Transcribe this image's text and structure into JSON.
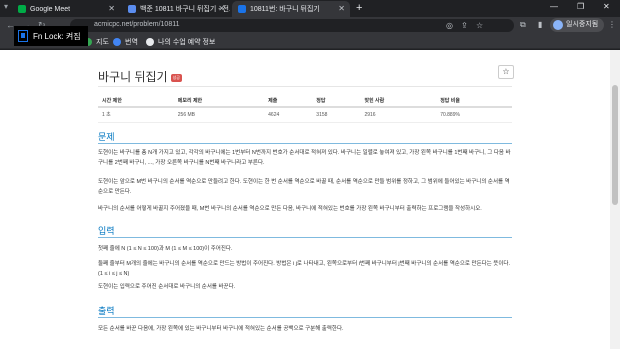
{
  "tabs": [
    {
      "label": "Google Meet",
      "active": false,
      "color": "#00ac47"
    },
    {
      "label": "백준 10811 바구니 뒤집기 - 전...",
      "active": false,
      "color": "#5b8def"
    },
    {
      "label": "10811번: 바구니 뒤집기",
      "active": true,
      "color": "#1a73e8"
    }
  ],
  "browser": {
    "url": "acmicpc.net/problem/10811",
    "profile_label": "일시중지됨"
  },
  "bookmarks": [
    {
      "label": "지도",
      "color": "#34a853"
    },
    {
      "label": "번역",
      "color": "#4285f4"
    },
    {
      "label": "나의 수업 예약 정보",
      "color": "#e8eaed"
    }
  ],
  "tooltip": {
    "label": "Fn Lock: 켜짐"
  },
  "problem": {
    "title": "바구니 뒤집기",
    "badge": "성공",
    "star_icon": "star-icon"
  },
  "stats": {
    "headers": [
      "시간 제한",
      "메모리 제한",
      "제출",
      "정답",
      "맞힌 사람",
      "정답 비율"
    ],
    "values": [
      "1 초",
      "256 MB",
      "4624",
      "3158",
      "2916",
      "70.889%"
    ]
  },
  "sections": {
    "problem_heading": "문제",
    "problem_paras": [
      "도현이는 바구니를 총 N개 가지고 있고, 각각의 바구니에는 1번부터 N번까지 번호가 순서대로 적혀져 있다. 바구니는 일렬로 놓여져 있고, 가장 왼쪽 바구니를 1번째 바구니, 그 다음 바구니를 2번째 바구니, ..., 가장 오른쪽 바구니를 N번째 바구니라고 부른다.",
      "도현이는 앞으로 M번 바구니의 순서를 역순으로 만들려고 한다. 도현이는 한 번 순서를 역순으로 바꿀 때, 순서를 역순으로 만들 범위를 정하고, 그 범위에 들어있는 바구니의 순서를 역순으로 만든다.",
      "바구니의 순서를 어떻게 바꿀지 주어졌을 때, M번 바구니의 순서를 역순으로 만든 다음, 바구니에 적혀있는 번호를 가장 왼쪽 바구니부터 출력하는 프로그램을 작성하시오."
    ],
    "input_heading": "입력",
    "input_paras": [
      "첫째 줄에 N (1 ≤ N ≤ 100)과 M (1 ≤ M ≤ 100)이 주어진다.",
      "둘째 줄부터 M개의 줄에는 바구니의 순서를 역순으로 만드는 방법이 주어진다. 방법은 i j로 나타내고, 왼쪽으로부터 i번째 바구니부터 j번째 바구니의 순서를 역순으로 만든다는 뜻이다. (1 ≤ i ≤ j ≤ N)",
      "도현이는 입력으로 주어진 순서대로 바구니의 순서를 바꾼다."
    ],
    "output_heading": "출력",
    "output_paras": [
      "모든 순서를 바꾼 다음에, 가장 왼쪽에 있는 바구니부터 바구니에 적혀있는 순서를 공백으로 구분해 출력한다."
    ]
  }
}
